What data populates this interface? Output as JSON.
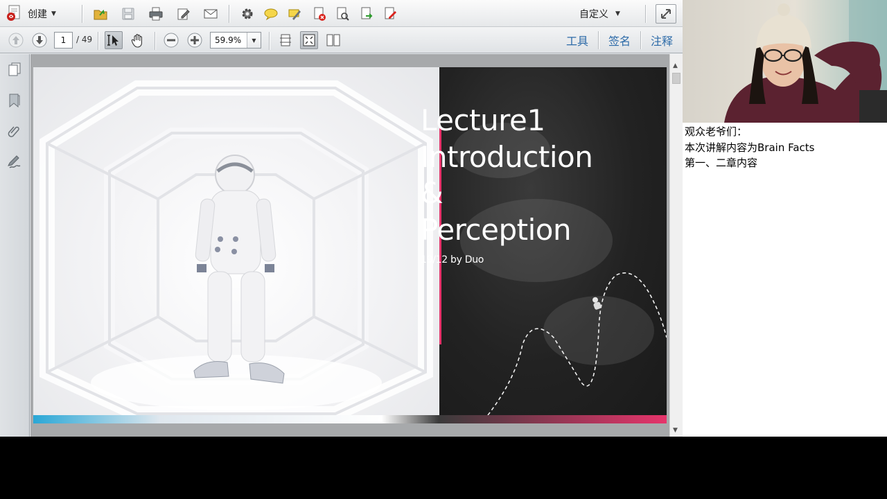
{
  "toolbar": {
    "create_label": "创建",
    "customize_label": "自定义"
  },
  "navigation": {
    "current_page": "1",
    "total_pages": "/ 49",
    "zoom": "59.9%"
  },
  "right_links": [
    {
      "label": "工具"
    },
    {
      "label": "签名"
    },
    {
      "label": "注释"
    }
  ],
  "slide": {
    "title_line1": "Lecture1",
    "title_line2": "Introduction",
    "title_line3": "&",
    "title_line4": "Perception",
    "subtitle": "19/12 by Duo",
    "accent_color": "#e6346b",
    "strip_colors": [
      "#2aa7d6",
      "#3a3a3a",
      "#e6346b"
    ]
  },
  "chat": {
    "lines": [
      "观众老爷们：",
      "本次讲解内容为Brain Facts",
      "第一、二章内容"
    ]
  }
}
